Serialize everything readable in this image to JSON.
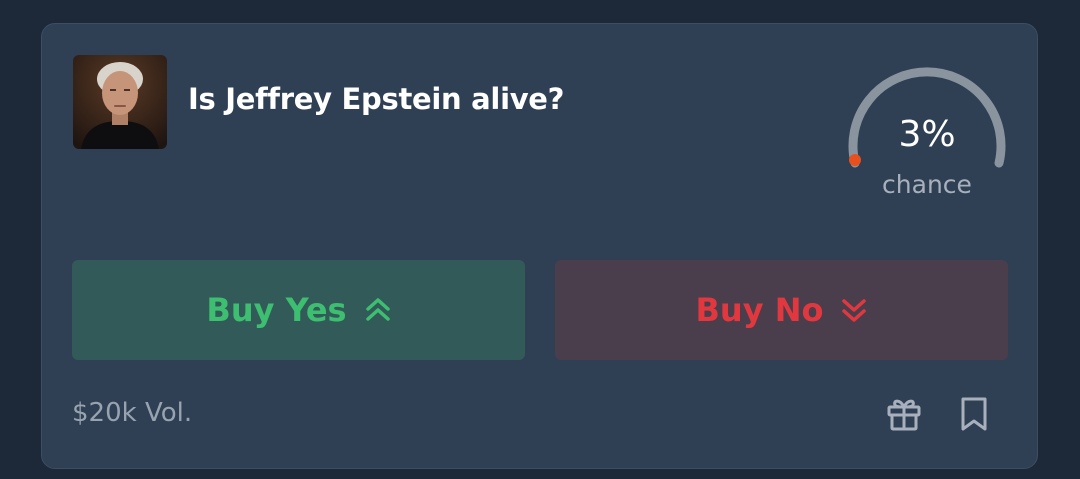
{
  "market": {
    "question": "Is Jeffrey Epstein alive?",
    "chance_value": "3%",
    "chance_fraction": 0.03,
    "chance_label": "chance",
    "volume": "$20k Vol."
  },
  "actions": {
    "buy_yes_label": "Buy Yes",
    "buy_no_label": "Buy No"
  },
  "icons": {
    "avatar": "portrait-photo",
    "buy_yes": "double-chevron-up-icon",
    "buy_no": "double-chevron-down-icon",
    "gift": "gift-icon",
    "bookmark": "bookmark-icon"
  },
  "colors": {
    "background": "#1d2838",
    "card": "#2f3f54",
    "yes": "#3dbe70",
    "yes_bg": "#325a58",
    "no": "#e0383e",
    "no_bg": "#4a3e4d",
    "gauge_track": "#8a949e",
    "gauge_indicator": "#e8501e"
  }
}
